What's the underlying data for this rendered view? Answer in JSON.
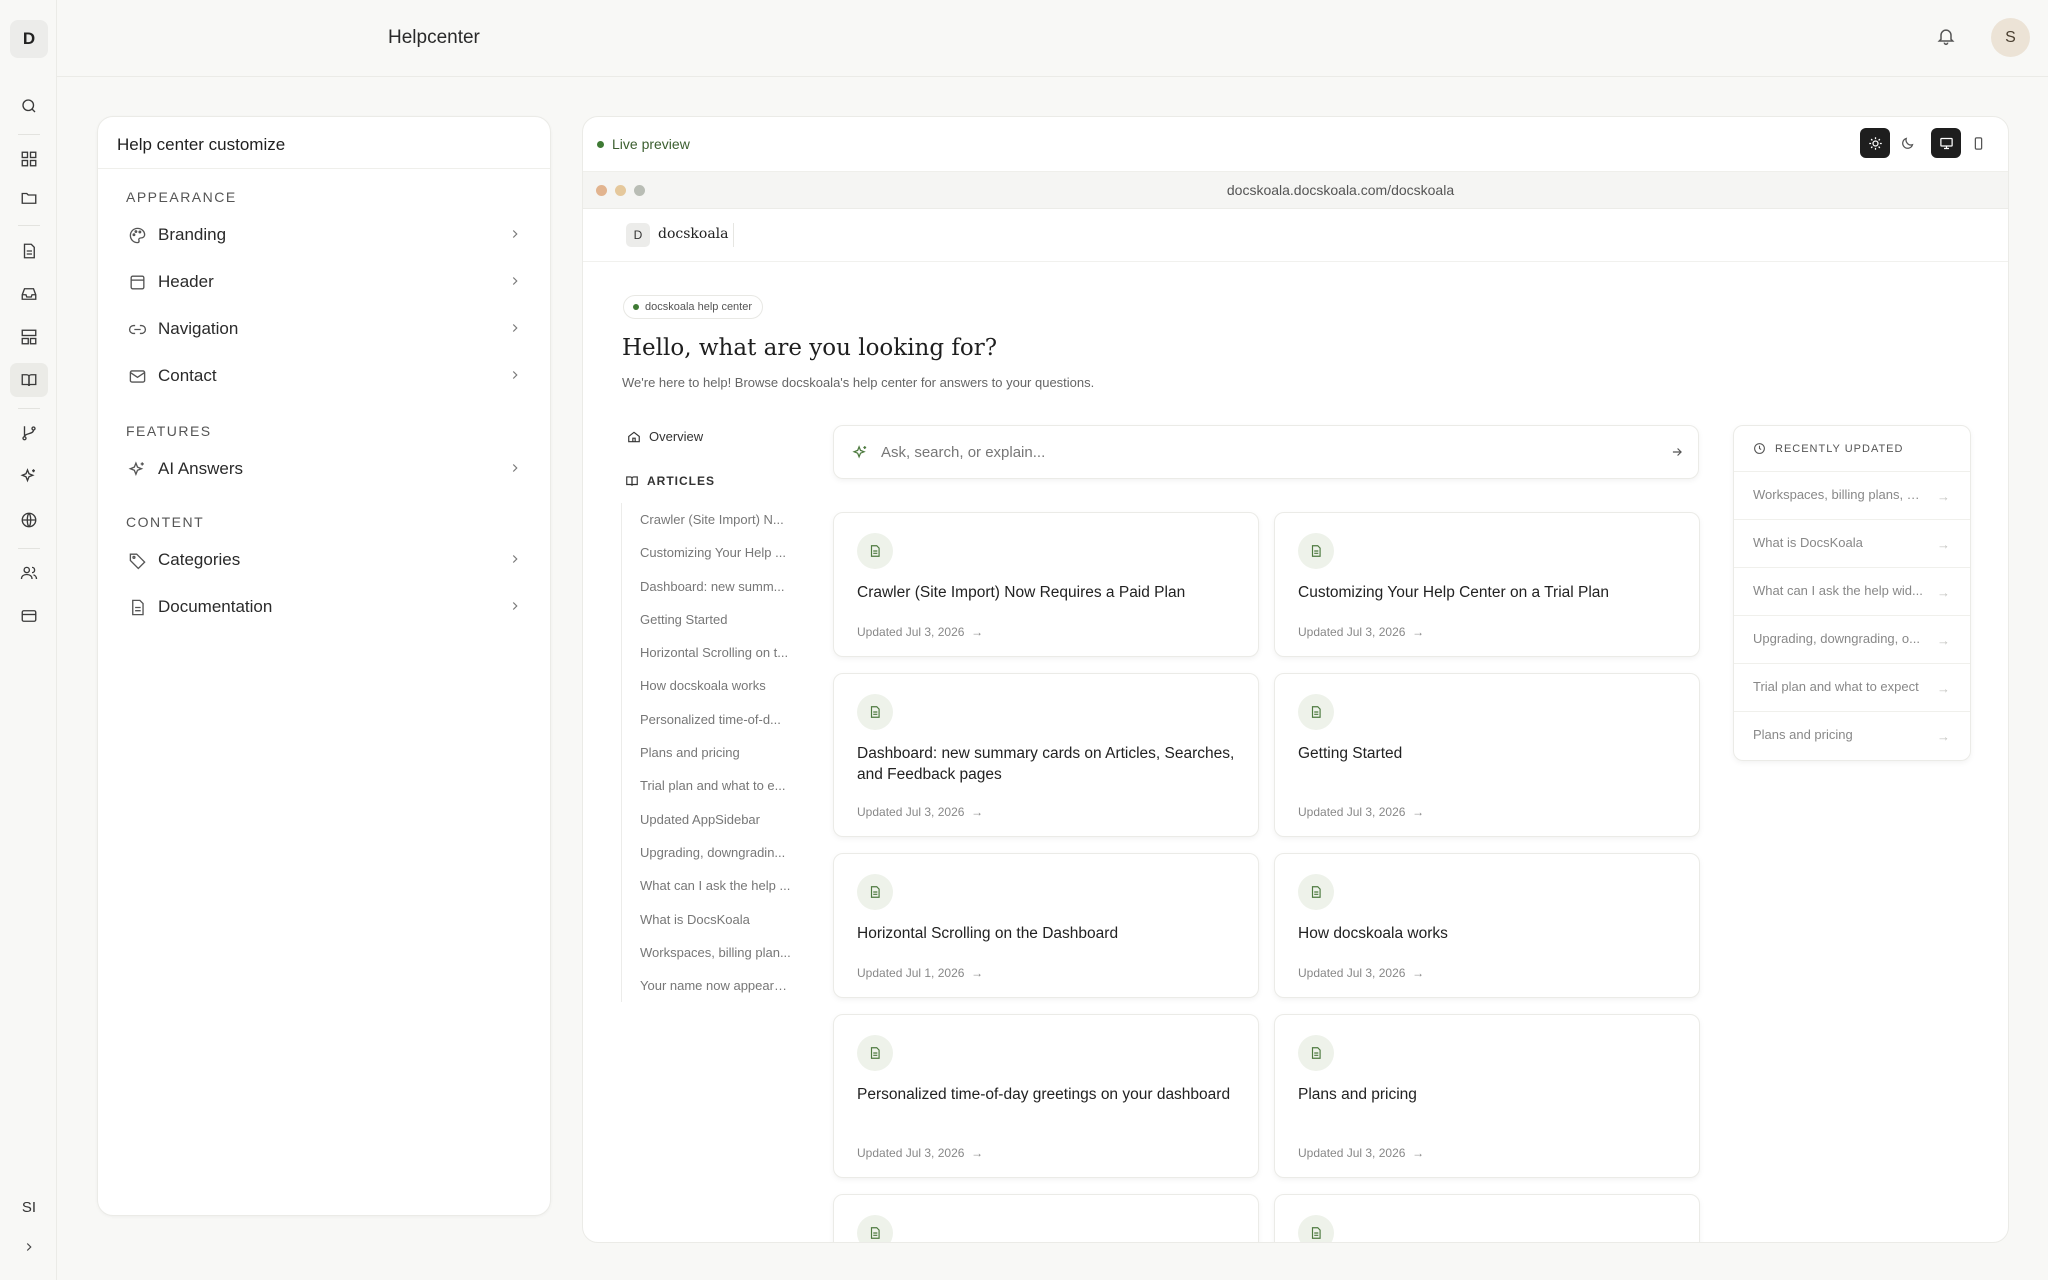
{
  "rail": {
    "logo": "D",
    "user_initials": "SI"
  },
  "topbar": {
    "title": "Helpcenter",
    "avatar": "S"
  },
  "customize": {
    "title": "Help center customize",
    "sections": [
      {
        "label": "APPEARANCE",
        "items": [
          "Branding",
          "Header",
          "Navigation",
          "Contact"
        ]
      },
      {
        "label": "FEATURES",
        "items": [
          "AI Answers"
        ]
      },
      {
        "label": "CONTENT",
        "items": [
          "Categories",
          "Documentation"
        ]
      }
    ]
  },
  "preview": {
    "live_label": "Live preview",
    "url": "docskoala.docskoala.com/docskoala",
    "site_logo": "D",
    "site_name": "docskoala",
    "badge": "docskoala help center",
    "hero_title": "Hello, what are you looking for?",
    "hero_subtitle": "We're here to help! Browse docskoala's help center for answers to your questions.",
    "sidebar": {
      "overview": "Overview",
      "articles_label": "ARTICLES",
      "articles": [
        "Crawler (Site Import) N...",
        "Customizing Your Help ...",
        "Dashboard: new summ...",
        "Getting Started",
        "Horizontal Scrolling on t...",
        "How docskoala works",
        "Personalized time-of-d...",
        "Plans and pricing",
        "Trial plan and what to e...",
        "Updated AppSidebar",
        "Upgrading, downgradin...",
        "What can I ask the help ...",
        "What is DocsKoala",
        "Workspaces, billing plan...",
        "Your name now appears..."
      ]
    },
    "search_placeholder": "Ask, search, or explain...",
    "cards": [
      {
        "title": "Crawler (Site Import) Now Requires a Paid Plan",
        "date": "Updated Jul 3, 2026"
      },
      {
        "title": "Customizing Your Help Center on a Trial Plan",
        "date": "Updated Jul 3, 2026"
      },
      {
        "title": "Dashboard: new summary cards on Articles, Searches, and Feedback pages",
        "date": "Updated Jul 3, 2026"
      },
      {
        "title": "Getting Started",
        "date": "Updated Jul 3, 2026"
      },
      {
        "title": "Horizontal Scrolling on the Dashboard",
        "date": "Updated Jul 1, 2026"
      },
      {
        "title": "How docskoala works",
        "date": "Updated Jul 3, 2026"
      },
      {
        "title": "Personalized time-of-day greetings on your dashboard",
        "date": "Updated Jul 3, 2026"
      },
      {
        "title": "Plans and pricing",
        "date": "Updated Jul 3, 2026"
      },
      {
        "title": "",
        "date": ""
      },
      {
        "title": "",
        "date": ""
      }
    ],
    "recent": {
      "label": "RECENTLY UPDATED",
      "items": [
        "Workspaces, billing plans, a...",
        "What is DocsKoala",
        "What can I ask the help wid...",
        "Upgrading, downgrading, o...",
        "Trial plan and what to expect",
        "Plans and pricing"
      ]
    }
  }
}
